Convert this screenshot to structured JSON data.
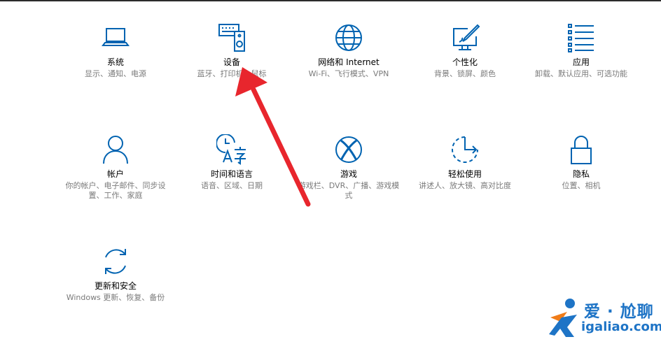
{
  "colors": {
    "icon": "#0063b1",
    "title": "#000000",
    "desc": "#7a7a7a",
    "arrow": "#e8262d",
    "watermark": "#1e74c6"
  },
  "tiles": [
    {
      "icon": "laptop-icon",
      "title": "系统",
      "desc": "显示、通知、电源"
    },
    {
      "icon": "keyboard-speaker-icon",
      "title": "设备",
      "desc": "蓝牙、打印机、鼠标"
    },
    {
      "icon": "globe-icon",
      "title": "网络和 Internet",
      "desc": "Wi-Fi、飞行模式、VPN"
    },
    {
      "icon": "paint-monitor-icon",
      "title": "个性化",
      "desc": "背景、锁屏、颜色"
    },
    {
      "icon": "app-list-icon",
      "title": "应用",
      "desc": "卸载、默认应用、可选功能"
    },
    {
      "icon": "person-icon",
      "title": "帐户",
      "desc": "你的帐户、电子邮件、同步设置、工作、家庭"
    },
    {
      "icon": "time-language-icon",
      "title": "时间和语言",
      "desc": "语音、区域、日期"
    },
    {
      "icon": "xbox-icon",
      "title": "游戏",
      "desc": "游戏栏、DVR、广播、游戏模式"
    },
    {
      "icon": "ease-of-access-icon",
      "title": "轻松使用",
      "desc": "讲述人、放大镜、高对比度"
    },
    {
      "icon": "lock-icon",
      "title": "隐私",
      "desc": "位置、相机"
    },
    {
      "icon": "sync-icon",
      "title": "更新和安全",
      "desc": "Windows 更新、恢复、备份"
    }
  ],
  "watermark": {
    "text_cn": "爱 · 尬聊",
    "url": "igaliao.com"
  }
}
